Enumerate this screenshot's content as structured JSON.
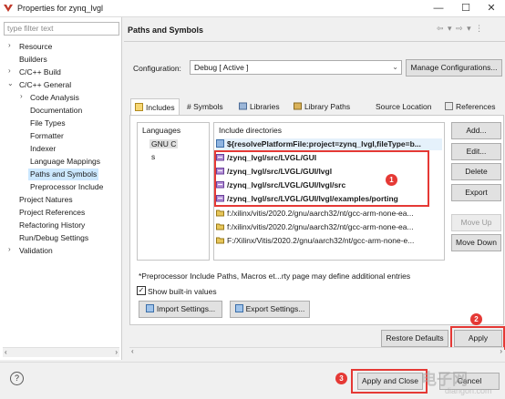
{
  "window": {
    "title": "Properties for zynq_lvgl",
    "minimize": "—",
    "maximize": "☐",
    "close": "✕"
  },
  "sidebar": {
    "filter_placeholder": "type filter text",
    "items": [
      {
        "label": "Resource",
        "expandable": true
      },
      {
        "label": "Builders"
      },
      {
        "label": "C/C++ Build",
        "expandable": true
      },
      {
        "label": "C/C++ General",
        "expanded": true
      },
      {
        "label": "Code Analysis",
        "expandable": true
      },
      {
        "label": "Documentation"
      },
      {
        "label": "File Types"
      },
      {
        "label": "Formatter"
      },
      {
        "label": "Indexer"
      },
      {
        "label": "Language Mappings"
      },
      {
        "label": "Paths and Symbols",
        "selected": true
      },
      {
        "label": "Preprocessor Include"
      },
      {
        "label": "Project Natures"
      },
      {
        "label": "Project References"
      },
      {
        "label": "Refactoring History"
      },
      {
        "label": "Run/Debug Settings"
      },
      {
        "label": "Validation",
        "expandable": true
      }
    ]
  },
  "page": {
    "title": "Paths and Symbols",
    "nav": "⇦ ▾ ⇨ ▾ ⋮"
  },
  "configuration": {
    "label": "Configuration:",
    "value": "Debug  [ Active ]",
    "manage_button": "Manage Configurations..."
  },
  "tabs": [
    {
      "label": "Includes",
      "active": true
    },
    {
      "label": "# Symbols"
    },
    {
      "label": "Libraries"
    },
    {
      "label": "Library Paths"
    },
    {
      "label": "Source Location"
    },
    {
      "label": "References"
    }
  ],
  "languages": {
    "header": "Languages",
    "items": [
      "GNU C",
      "s"
    ]
  },
  "include_dirs": {
    "header": "Include directories",
    "items": [
      "${resolvePlatformFile:project=zynq_lvgl,fileType=b...",
      "/zynq_lvgl/src/LVGL/GUI",
      "/zynq_lvgl/src/LVGL/GUI/lvgl",
      "/zynq_lvgl/src/LVGL/GUI/lvgl/src",
      "/zynq_lvgl/src/LVGL/GUI/lvgl/examples/porting",
      "f:/xilinx/vitis/2020.2/gnu/aarch32/nt/gcc-arm-none-ea...",
      "f:/xilinx/vitis/2020.2/gnu/aarch32/nt/gcc-arm-none-ea...",
      "F:/Xilinx/Vitis/2020.2/gnu/aarch32/nt/gcc-arm-none-e..."
    ]
  },
  "side_buttons": {
    "add": "Add...",
    "edit": "Edit...",
    "delete": "Delete",
    "export": "Export",
    "move_up": "Move Up",
    "move_down": "Move Down"
  },
  "note": "*Preprocessor Include Paths, Macros et...rty page may define additional entries",
  "show_builtin": {
    "label": "Show built-in values",
    "checked": true
  },
  "import_button": "Import Settings...",
  "export_button": "Export Settings...",
  "restore_defaults": "Restore Defaults",
  "apply": "Apply",
  "apply_and_close": "Apply and Close",
  "cancel": "Cancel",
  "help_icon_glyph": "?",
  "annotations": {
    "badge1": "1",
    "badge2": "2",
    "badge3": "3",
    "accent": "#e53935"
  },
  "watermark": {
    "line1": "电子网",
    "line2": "diangon.com"
  }
}
